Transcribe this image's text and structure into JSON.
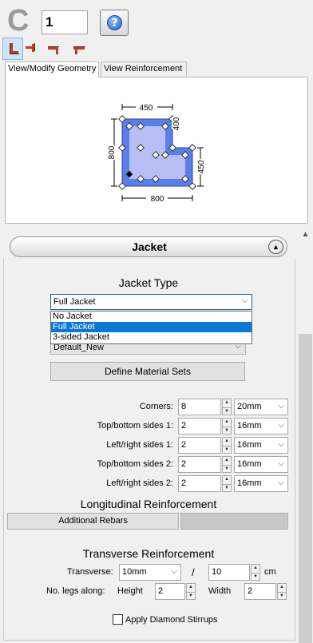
{
  "header": {
    "section_letter": "C",
    "section_number": "1",
    "help_icon": "help-question-icon",
    "shape_buttons": [
      "l-shape-1-icon",
      "l-shape-2-icon",
      "t-shape-1-icon",
      "t-shape-2-icon"
    ]
  },
  "tabs": [
    {
      "label": "View/Modify Geometry",
      "active": true
    },
    {
      "label": "View Reinforcement",
      "active": false
    }
  ],
  "geometry": {
    "dim_top": "450",
    "dim_top_right": "400",
    "dim_left": "800",
    "dim_right": "450",
    "dim_bottom": "800",
    "fill_color": "#5b7fe8",
    "inner_color": "#b9bff5"
  },
  "section": {
    "title": "Jacket",
    "collapse_icon": "collapse-up-icon"
  },
  "jacket": {
    "heading": "Jacket Type",
    "selected": "Full Jacket",
    "options": [
      "No Jacket",
      "Full Jacket",
      "3-sided Jacket"
    ],
    "highlighted_index": 1,
    "material_set": "Default_New",
    "define_button": "Define Material Sets"
  },
  "rebars": [
    {
      "label": "Corners:",
      "count": "8",
      "diameter": "20mm"
    },
    {
      "label": "Top/bottom sides 1:",
      "count": "2",
      "diameter": "16mm"
    },
    {
      "label": "Left/right sides 1:",
      "count": "2",
      "diameter": "16mm"
    },
    {
      "label": "Top/bottom sides 2:",
      "count": "2",
      "diameter": "16mm"
    },
    {
      "label": "Left/right sides 2:",
      "count": "2",
      "diameter": "16mm"
    }
  ],
  "longitudinal": {
    "heading": "Longitudinal Reinforcement",
    "additional_button": "Additional Rebars"
  },
  "transverse": {
    "heading": "Transverse Reinforcement",
    "label": "Transverse:",
    "diameter": "10mm",
    "slash": "/",
    "spacing": "10",
    "unit": "cm",
    "legs_label": "No. legs along:",
    "height_label": "Height",
    "height_value": "2",
    "width_label": "Width",
    "width_value": "2",
    "diamond_label": "Apply Diamond Stirrups"
  }
}
